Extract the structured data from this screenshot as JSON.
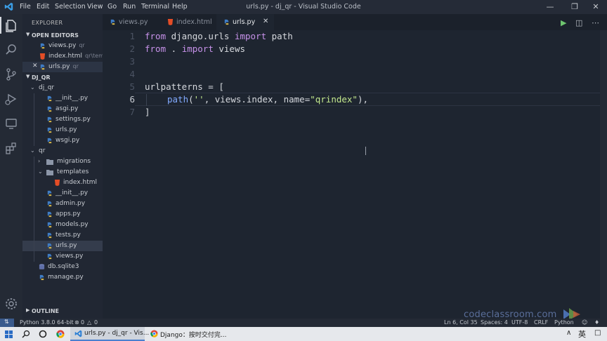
{
  "titlebar": {
    "menus": [
      "File",
      "Edit",
      "Selection",
      "View",
      "Go",
      "Run",
      "Terminal",
      "Help"
    ],
    "window_title": "urls.py - dj_qr - Visual Studio Code"
  },
  "sidebar": {
    "header": "EXPLORER",
    "open_editors": {
      "title": "OPEN EDITORS",
      "items": [
        {
          "name": "views.py",
          "hint": "qr",
          "type": "python"
        },
        {
          "name": "index.html",
          "hint": "qr\\tem...",
          "type": "html"
        },
        {
          "name": "urls.py",
          "hint": "qr",
          "type": "python"
        }
      ]
    },
    "project": {
      "title": "DJ_QR",
      "tree": [
        {
          "name": "dj_qr",
          "type": "folder-open"
        },
        {
          "name": "__init__.py",
          "type": "python"
        },
        {
          "name": "asgi.py",
          "type": "python"
        },
        {
          "name": "settings.py",
          "type": "python"
        },
        {
          "name": "urls.py",
          "type": "python"
        },
        {
          "name": "wsgi.py",
          "type": "python"
        },
        {
          "name": "qr",
          "type": "folder-open"
        },
        {
          "name": "migrations",
          "type": "folder"
        },
        {
          "name": "templates",
          "type": "folder-open"
        },
        {
          "name": "index.html",
          "type": "html"
        },
        {
          "name": "__init__.py",
          "type": "python"
        },
        {
          "name": "admin.py",
          "type": "python"
        },
        {
          "name": "apps.py",
          "type": "python"
        },
        {
          "name": "models.py",
          "type": "python"
        },
        {
          "name": "tests.py",
          "type": "python"
        },
        {
          "name": "urls.py",
          "type": "python"
        },
        {
          "name": "views.py",
          "type": "python"
        },
        {
          "name": "db.sqlite3",
          "type": "db"
        },
        {
          "name": "manage.py",
          "type": "python"
        }
      ]
    },
    "outline": "OUTLINE"
  },
  "tabs": [
    {
      "label": "views.py",
      "type": "python",
      "active": false
    },
    {
      "label": "index.html",
      "type": "html",
      "active": false
    },
    {
      "label": "urls.py",
      "type": "python",
      "active": true
    }
  ],
  "editor": {
    "line_numbers": [
      "1",
      "2",
      "3",
      "4",
      "5",
      "6",
      "7"
    ],
    "line1": {
      "kw1": "from",
      "t1": " django.urls ",
      "kw2": "import",
      "t2": " path"
    },
    "line2": {
      "kw1": "from",
      "t1": " . ",
      "kw2": "import",
      "t2": " views"
    },
    "line5": "urlpatterns = [",
    "line6": {
      "fn": "path",
      "p1": "(",
      "s1": "''",
      "t1": ", views.index, name=",
      "s2": "\"qrindex\"",
      "t2": "),"
    },
    "line7": "]"
  },
  "statusbar": {
    "interpreter": "Python 3.8.0 64-bit",
    "problems": "0",
    "warnings": "0",
    "cursor": "Ln 6, Col 35",
    "spaces": "Spaces: 4",
    "encoding": "UTF-8",
    "eol": "CRLF",
    "language": "Python"
  },
  "taskbar": {
    "vscode_label": "urls.py - dj_qr - Vis...",
    "chrome_label": "Django：按时交付完...",
    "ime": "英"
  },
  "watermark": "codeclassroom.com",
  "colors": {
    "accent": "#4a7fd0",
    "keyword": "#c792ea",
    "string": "#c3e88d",
    "function": "#82aaff",
    "python_icon": "#e4c24a",
    "html_icon": "#e44d26"
  }
}
